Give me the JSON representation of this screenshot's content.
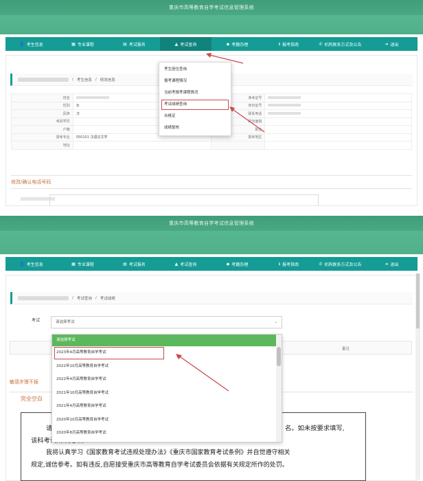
{
  "app_title": "重庆市高等教育自学考试信息管理系统",
  "nav": [
    {
      "icon": "user-icon",
      "glyph": "👤",
      "label": "考生信息"
    },
    {
      "icon": "grid-icon",
      "glyph": "▦",
      "label": "专业课程"
    },
    {
      "icon": "list-icon",
      "glyph": "▤",
      "label": "考试报名"
    },
    {
      "icon": "chart-icon",
      "glyph": "▲",
      "label": "考试查询"
    },
    {
      "icon": "tag-icon",
      "glyph": "◆",
      "label": "考籍办理"
    },
    {
      "icon": "info-icon",
      "glyph": "ℹ",
      "label": "报考指南"
    },
    {
      "icon": "phone-icon",
      "glyph": "✆",
      "label": "机构联系方式及公告"
    },
    {
      "icon": "exit-icon",
      "glyph": "➜",
      "label": "退出"
    }
  ],
  "panel1": {
    "breadcrumb": [
      "考生信息",
      "修改信息"
    ],
    "menu": [
      "考生座位查询",
      "报考课程情况",
      "当前考报考课程情况",
      "考试成绩查询",
      "合格证",
      "成绩复核"
    ],
    "menu_highlight_index": 3,
    "rows": [
      {
        "l": "姓名",
        "v": "",
        "rl": "准考证号",
        "rv": ""
      },
      {
        "l": "性别",
        "v": "女",
        "rl": "身份证号",
        "rv": ""
      },
      {
        "l": "民族",
        "v": "汉",
        "rl": "联系电话",
        "rv": ""
      },
      {
        "l": "考前学历",
        "v": "",
        "rl": "政治面貌",
        "rv": ""
      },
      {
        "l": "户籍",
        "v": "",
        "rl": "职业",
        "rv": ""
      },
      {
        "l": "报考专业",
        "v": "050101 汉语言文学",
        "rl": "报考地区",
        "rv": ""
      },
      {
        "l": "地址",
        "v": "",
        "rl": "",
        "rv": ""
      }
    ],
    "section_title": "修改/确认电话号码"
  },
  "panel2": {
    "breadcrumb": [
      "考试查询",
      "考试成绩"
    ],
    "exam_label": "考试",
    "select_value": "请选择考试",
    "table_header_note": "备注",
    "options": [
      "请选择考试",
      "2023年4月高等教育自学考试",
      "2022年10月高等教育自学考试",
      "2022年4月高等教育自学考试",
      "2021年10月高等教育自学考试",
      "2021年4月高等教育自学考试",
      "2020年10月高等教育自学考试",
      "2020年8月高等教育自学考试"
    ],
    "option_highlight_index": 1,
    "side_note": "敏感步骤不报",
    "blank_note": "完全空白",
    "notice": {
      "line1_left": "请",
      "line1_right": "名。如未按要求填写,",
      "line2": "该科考试成绩无效。",
      "line3": "我将认真学习《国家教育考试违规处理办法》《重庆市国家教育考试条例》并自觉遵守相关",
      "line4": "规定,诚信参考。如有违反,自愿接受重庆市高等教育自学考试委员会依据有关规定所作的处罚。"
    }
  },
  "colors": {
    "nav_bg": "#149c95",
    "header_green": "#4aa984",
    "highlight_red": "#c84a4a",
    "accent_orange": "#c7723a",
    "option_green": "#5cb85c"
  }
}
